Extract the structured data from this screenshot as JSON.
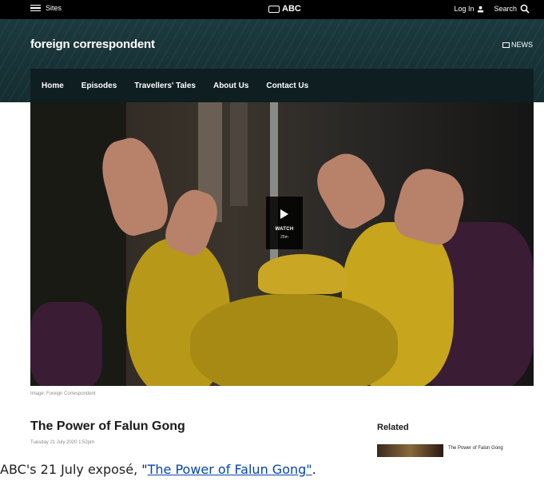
{
  "topbar": {
    "sites_label": "Sites",
    "logo_text": "ABC",
    "login_label": "Log In",
    "search_label": "Search"
  },
  "banner": {
    "brand": "foreign correspondent",
    "news_label": "NEWS"
  },
  "nav": {
    "items": [
      "Home",
      "Episodes",
      "Travellers' Tales",
      "About Us",
      "Contact Us"
    ]
  },
  "hero": {
    "watch_label": "WATCH",
    "duration": "25m"
  },
  "article": {
    "image_caption": "Image: Foreign Correspondent",
    "title": "The Power of Falun Gong",
    "date": "Tuesday 21 July 2020 1:52pm"
  },
  "related": {
    "heading": "Related",
    "item_title": "The Power of Falun Gong"
  },
  "figure_caption": {
    "prefix": "ABC's 21 July  exposé, \"",
    "link_text": "The Power of Falun Gong\"",
    "suffix": "."
  }
}
